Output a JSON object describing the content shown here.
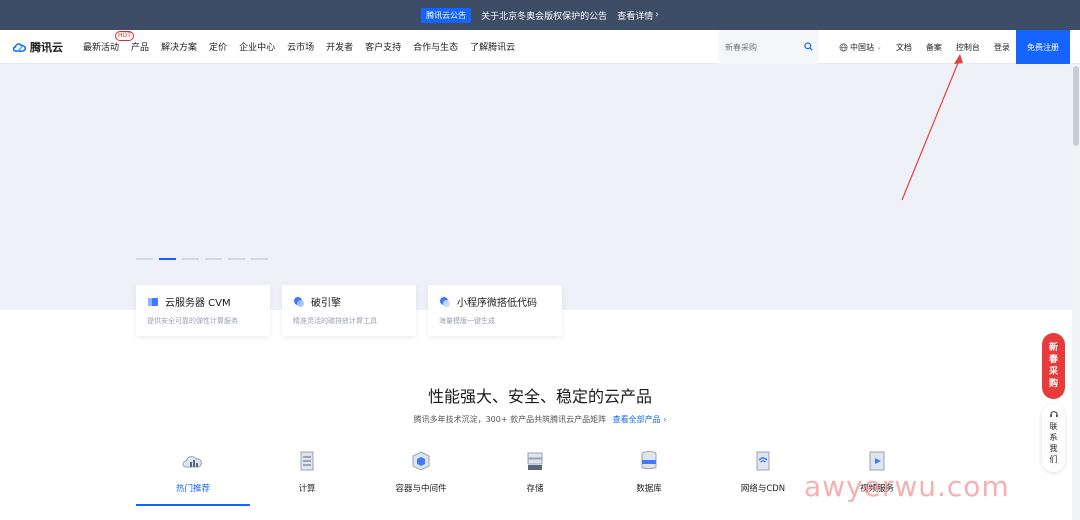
{
  "announcement": {
    "tag": "腾讯云公告",
    "text": "关于北京冬奥会版权保护的公告",
    "more": "查看详情"
  },
  "nav": {
    "logo": "腾讯云",
    "items": [
      "最新活动",
      "产品",
      "解决方案",
      "定价",
      "企业中心",
      "云市场",
      "开发者",
      "客户支持",
      "合作与生态",
      "了解腾讯云"
    ],
    "hot_badge": "HOT",
    "search_placeholder": "新春采购",
    "region": "中国站",
    "docs": "文档",
    "filing": "备案",
    "console": "控制台",
    "login": "登录",
    "register": "免费注册"
  },
  "hero": {
    "cards": [
      {
        "title": "云服务器 CVM",
        "desc": "提供安全可靠的弹性计算服务"
      },
      {
        "title": "破引擎",
        "desc": "精准灵活的碳排放计算工具"
      },
      {
        "title": "小程序微搭低代码",
        "desc": "海量模版一键生成"
      }
    ]
  },
  "section": {
    "title": "性能强大、安全、稳定的云产品",
    "subtitle": "腾讯多年技术沉淀，300+ 款产品共筑腾讯云产品矩阵",
    "link": "查看全部产品",
    "tabs": [
      "热门推荐",
      "计算",
      "容器与中间件",
      "存储",
      "数据库",
      "网络与CDN",
      "视频服务"
    ]
  },
  "float": {
    "promo": [
      "新",
      "春",
      "采",
      "购"
    ],
    "contact": [
      "联",
      "系",
      "我",
      "们"
    ]
  },
  "watermark": "awyerwu.com",
  "colors": {
    "brand": "#1664ff",
    "announce_bg": "#3d4d66",
    "promo_red": "#e73a3a"
  }
}
